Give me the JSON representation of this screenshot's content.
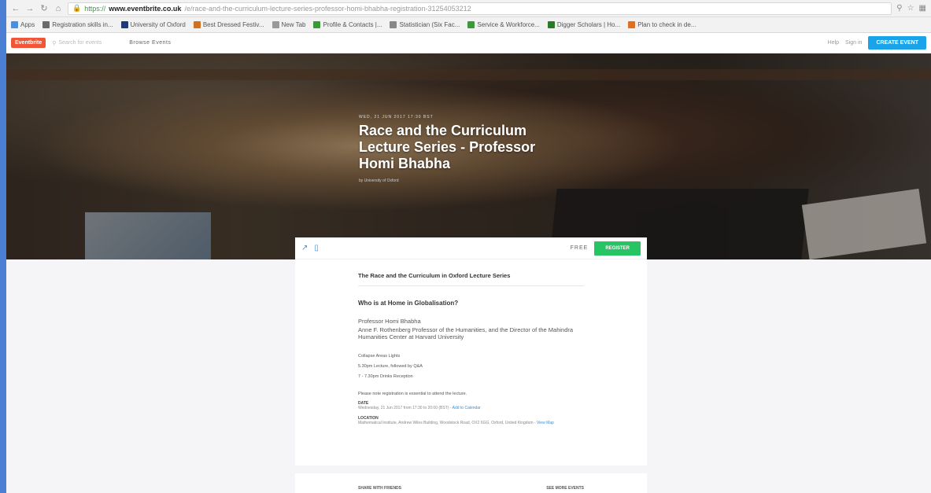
{
  "browser": {
    "url_protocol": "https://",
    "url_domain": "www.eventbrite.co.uk",
    "url_path": "/e/race-and-the-curriculum-lecture-series-professor-homi-bhabha-registration-31254053212"
  },
  "bookmarks": [
    {
      "label": "Apps",
      "color": "#4a8ee0"
    },
    {
      "label": "Registration skills in...",
      "color": "#6a6a6a"
    },
    {
      "label": "University of Oxford",
      "color": "#1e3a78"
    },
    {
      "label": "Best Dressed Festiv...",
      "color": "#d07020"
    },
    {
      "label": "New Tab",
      "color": "#999999"
    },
    {
      "label": "Profile & Contacts |...",
      "color": "#3a9a3a"
    },
    {
      "label": "Statistician (Six Fac...",
      "color": "#888888"
    },
    {
      "label": "Service & Workforce...",
      "color": "#3a9a3a"
    },
    {
      "label": "Digger Scholars | Ho...",
      "color": "#2a7a2a"
    },
    {
      "label": "Plan to check in de...",
      "color": "#e07020"
    }
  ],
  "site": {
    "logo": "Eventbrite",
    "search_placeholder": "Search for events",
    "browse": "Browse Events",
    "help": "Help",
    "signin": "Sign in",
    "create": "CREATE EVENT"
  },
  "hero": {
    "date": "WED, 21 JUN 2017 17:30 BST",
    "title": "Race and the Curriculum Lecture Series - Professor Homi Bhabha",
    "organizer": "by University of Oxford"
  },
  "ticket": {
    "price": "FREE",
    "register": "REGISTER"
  },
  "content": {
    "heading": "The Race and the Curriculum in Oxford Lecture Series",
    "question": "Who is at Home in Globalisation?",
    "speaker": "Professor Homi Bhabha",
    "role": "Anne F. Rothenberg Professor of the Humanities, and the Director of the Mahindra Humanities Center at Harvard University",
    "info": [
      "Collapse Areas Lights",
      "5.30pm Lecture, followed by Q&A",
      "7 - 7.30pm Drinks Reception"
    ],
    "note": "Please note registration is essential to attend the lecture.",
    "date_label": "DATE",
    "date_value": "Wednesday, 21 Jun 2017 from 17:30 to 20:00 (BST) - ",
    "date_link": "Add to Calendar",
    "location_label": "LOCATION",
    "location_value": "Mathematical Institute, Andrew Wiles Building, Woodstock Road, OX2 6GG, Oxford, United Kingdom - ",
    "location_link": "View Map"
  },
  "lower": {
    "left": "SHARE WITH FRIENDS",
    "right": "SEE MORE EVENTS"
  }
}
